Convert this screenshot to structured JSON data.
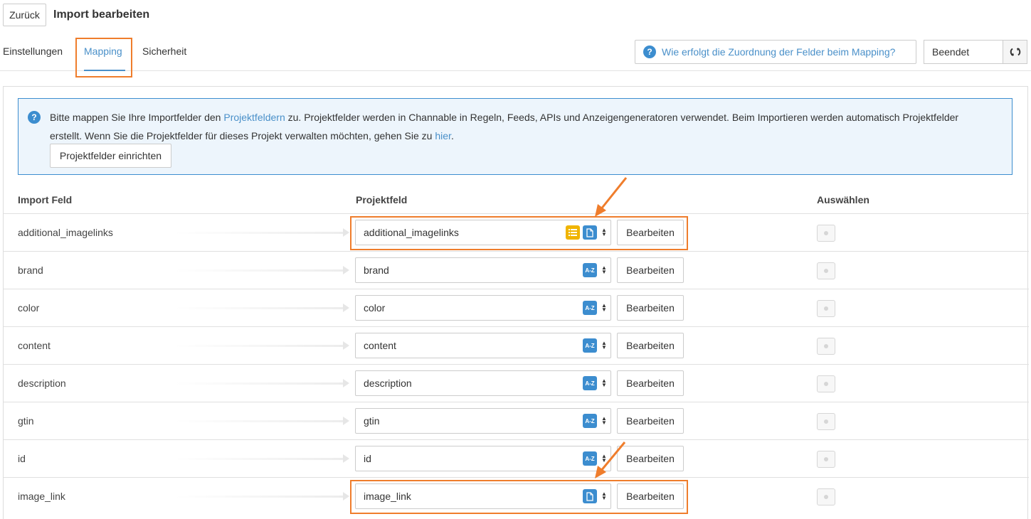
{
  "header": {
    "back_label": "Zurück",
    "title": "Import bearbeiten"
  },
  "tabs": [
    {
      "label": "Einstellungen"
    },
    {
      "label": "Mapping"
    },
    {
      "label": "Sicherheit"
    }
  ],
  "toolbar": {
    "help_label": "Wie erfolgt die Zuordnung der Felder beim Mapping?",
    "status_value": "Beendet"
  },
  "info": {
    "text_part1": "Bitte mappen Sie Ihre Importfelder den ",
    "link1": "Projektfeldern",
    "text_part2": " zu. Projektfelder werden in Channable in Regeln, Feeds, APIs und Anzeigengeneratoren verwendet. Beim Importieren werden automatisch Projektfelder erstellt. Wenn Sie die Projektfelder für dieses Projekt verwalten möchten, gehen Sie zu ",
    "link2": "hier",
    "text_part3": ".",
    "setup_button": "Projektfelder einrichten"
  },
  "table": {
    "headers": {
      "import": "Import Feld",
      "projekt": "Projektfeld",
      "auswahl": "Auswählen"
    },
    "edit_label": "Bearbeiten",
    "rows": [
      {
        "import": "additional_imagelinks",
        "projekt": "additional_imagelinks",
        "badges": [
          "list-icon",
          "file-icon"
        ]
      },
      {
        "import": "brand",
        "projekt": "brand",
        "badges": [
          "az-icon"
        ]
      },
      {
        "import": "color",
        "projekt": "color",
        "badges": [
          "az-icon"
        ]
      },
      {
        "import": "content",
        "projekt": "content",
        "badges": [
          "az-icon"
        ]
      },
      {
        "import": "description",
        "projekt": "description",
        "badges": [
          "az-icon"
        ]
      },
      {
        "import": "gtin",
        "projekt": "gtin",
        "badges": [
          "az-icon"
        ]
      },
      {
        "import": "id",
        "projekt": "id",
        "badges": [
          "az-icon"
        ]
      },
      {
        "import": "image_link",
        "projekt": "image_link",
        "badges": [
          "file-icon"
        ]
      }
    ]
  },
  "colors": {
    "accent": "#4a90c9",
    "highlight": "#ef7d2c",
    "badge_blue": "#3c8dcf",
    "badge_yellow": "#f0b400"
  }
}
